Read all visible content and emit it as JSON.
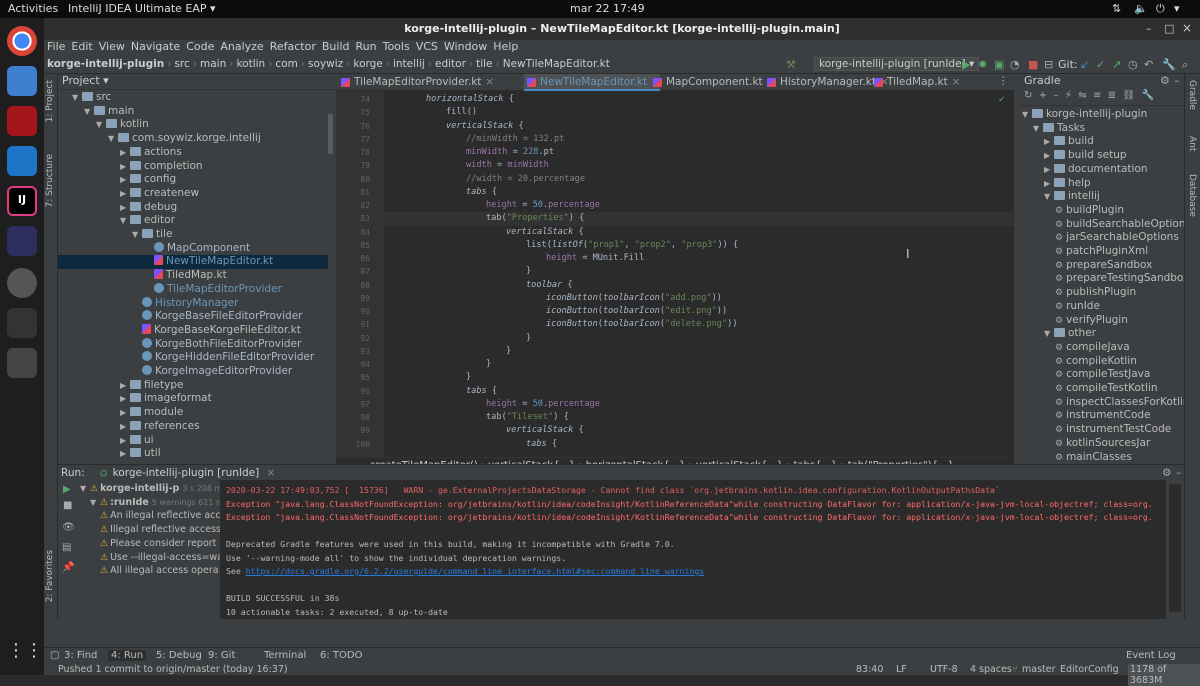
{
  "gnome": {
    "activities": "Activities",
    "app": "IntelliJ IDEA Ultimate EAP ▾",
    "clock": "mar 22  17:49"
  },
  "window": {
    "title": "korge-intellij-plugin – NewTileMapEditor.kt [korge-intellij-plugin.main]"
  },
  "menu": [
    "File",
    "Edit",
    "View",
    "Navigate",
    "Code",
    "Analyze",
    "Refactor",
    "Build",
    "Run",
    "Tools",
    "VCS",
    "Window",
    "Help"
  ],
  "nav": {
    "crumbs": [
      "korge-intellij-plugin",
      "src",
      "main",
      "kotlin",
      "com",
      "soywiz",
      "korge",
      "intellij",
      "editor",
      "tile",
      "NewTileMapEditor.kt"
    ],
    "run_config": "korge-intellij-plugin [runIde] ▾",
    "git": "Git:"
  },
  "left_strip": {
    "project": "1: Project",
    "structure": "7: Structure",
    "favorites": "2: Favorites"
  },
  "right_strip": {
    "gradle": "Gradle",
    "ant": "Ant",
    "database": "Database"
  },
  "project": {
    "header": "Project ▾",
    "rows": [
      {
        "label": "src",
        "depth": 1,
        "open": true,
        "kind": "folder"
      },
      {
        "label": "main",
        "depth": 2,
        "open": true,
        "kind": "folder"
      },
      {
        "label": "kotlin",
        "depth": 3,
        "open": true,
        "kind": "folder"
      },
      {
        "label": "com.soywiz.korge.intellij",
        "depth": 4,
        "open": true,
        "kind": "folder"
      },
      {
        "label": "actions",
        "depth": 5,
        "open": false,
        "kind": "folder"
      },
      {
        "label": "completion",
        "depth": 5,
        "open": false,
        "kind": "folder"
      },
      {
        "label": "config",
        "depth": 5,
        "open": false,
        "kind": "folder"
      },
      {
        "label": "createnew",
        "depth": 5,
        "open": false,
        "kind": "folder"
      },
      {
        "label": "debug",
        "depth": 5,
        "open": false,
        "kind": "folder"
      },
      {
        "label": "editor",
        "depth": 5,
        "open": true,
        "kind": "folder"
      },
      {
        "label": "tile",
        "depth": 6,
        "open": true,
        "kind": "folder"
      },
      {
        "label": "MapComponent",
        "depth": 7,
        "kind": "class"
      },
      {
        "label": "NewTileMapEditor.kt",
        "depth": 7,
        "kind": "kt",
        "selected": true
      },
      {
        "label": "TiledMap.kt",
        "depth": 7,
        "kind": "kt"
      },
      {
        "label": "TileMapEditorProvider",
        "depth": 7,
        "kind": "class"
      },
      {
        "label": "HistoryManager",
        "depth": 6,
        "kind": "class"
      },
      {
        "label": "KorgeBaseFileEditorProvider",
        "depth": 6,
        "kind": "class"
      },
      {
        "label": "KorgeBaseKorgeFileEditor.kt",
        "depth": 6,
        "kind": "kt"
      },
      {
        "label": "KorgeBothFileEditorProvider",
        "depth": 6,
        "kind": "class"
      },
      {
        "label": "KorgeHiddenFileEditorProvider",
        "depth": 6,
        "kind": "class"
      },
      {
        "label": "KorgeImageEditorProvider",
        "depth": 6,
        "kind": "class"
      },
      {
        "label": "filetype",
        "depth": 5,
        "open": false,
        "kind": "folder"
      },
      {
        "label": "imageformat",
        "depth": 5,
        "open": false,
        "kind": "folder"
      },
      {
        "label": "module",
        "depth": 5,
        "open": false,
        "kind": "folder"
      },
      {
        "label": "references",
        "depth": 5,
        "open": false,
        "kind": "folder"
      },
      {
        "label": "ui",
        "depth": 5,
        "open": false,
        "kind": "folder"
      },
      {
        "label": "util",
        "depth": 5,
        "open": false,
        "kind": "folder"
      }
    ]
  },
  "tabs": [
    {
      "label": "TileMapEditorProvider.kt",
      "active": false
    },
    {
      "label": "NewTileMapEditor.kt",
      "active": true
    },
    {
      "label": "MapComponent.kt",
      "active": false
    },
    {
      "label": "HistoryManager.kt",
      "active": false
    },
    {
      "label": "TiledMap.kt",
      "active": false
    }
  ],
  "code": {
    "current_line": 83,
    "lines": [
      {
        "n": 74,
        "i": 2,
        "t": [
          [
            "horizontalStack",
            "it"
          ],
          [
            " {",
            ""
          ]
        ]
      },
      {
        "n": 75,
        "i": 3,
        "t": [
          [
            "fill()",
            ""
          ]
        ]
      },
      {
        "n": 76,
        "i": 3,
        "t": [
          [
            "verticalStack",
            "it"
          ],
          [
            " {",
            ""
          ]
        ]
      },
      {
        "n": 77,
        "i": 4,
        "t": [
          [
            "//minWidth = 132.pt",
            "cmt"
          ]
        ]
      },
      {
        "n": 78,
        "i": 4,
        "t": [
          [
            "minWidth",
            "prop"
          ],
          [
            " = ",
            ""
          ],
          [
            "228",
            "num"
          ],
          [
            ".pt",
            ""
          ]
        ]
      },
      {
        "n": 79,
        "i": 4,
        "t": [
          [
            "width",
            "prop"
          ],
          [
            " = ",
            ""
          ],
          [
            "minWidth",
            "prop"
          ]
        ]
      },
      {
        "n": 80,
        "i": 4,
        "t": [
          [
            "//width = 20.percentage",
            "cmt"
          ]
        ]
      },
      {
        "n": 81,
        "i": 4,
        "t": [
          [
            "tabs",
            "it"
          ],
          [
            " {",
            ""
          ]
        ]
      },
      {
        "n": 82,
        "i": 5,
        "t": [
          [
            "height",
            "prop"
          ],
          [
            " = ",
            ""
          ],
          [
            "50",
            "num"
          ],
          [
            ".",
            ""
          ],
          [
            "percentage",
            "prop"
          ]
        ]
      },
      {
        "n": 83,
        "i": 5,
        "t": [
          [
            "tab(",
            ""
          ],
          [
            "\"Properties\"",
            "str"
          ],
          [
            ") {",
            ""
          ]
        ]
      },
      {
        "n": 84,
        "i": 6,
        "t": [
          [
            "verticalStack",
            "it"
          ],
          [
            " {",
            ""
          ]
        ]
      },
      {
        "n": 85,
        "i": 7,
        "t": [
          [
            "list(",
            ""
          ],
          [
            "listOf",
            "it"
          ],
          [
            "(",
            ""
          ],
          [
            "\"prop1\"",
            "str"
          ],
          [
            ", ",
            ""
          ],
          [
            "\"prop2\"",
            "str"
          ],
          [
            ", ",
            ""
          ],
          [
            "\"prop3\"",
            "str"
          ],
          [
            ")) {",
            ""
          ]
        ]
      },
      {
        "n": 86,
        "i": 8,
        "t": [
          [
            "height",
            "prop"
          ],
          [
            " = MUnit.Fill",
            ""
          ]
        ]
      },
      {
        "n": 87,
        "i": 7,
        "t": [
          [
            "}",
            ""
          ]
        ]
      },
      {
        "n": 88,
        "i": 7,
        "t": [
          [
            "toolbar",
            "it"
          ],
          [
            " {",
            ""
          ]
        ]
      },
      {
        "n": 89,
        "i": 8,
        "t": [
          [
            "iconButton",
            "it"
          ],
          [
            "(",
            ""
          ],
          [
            "toolbarIcon",
            "it"
          ],
          [
            "(",
            ""
          ],
          [
            "\"add.png\"",
            "str"
          ],
          [
            "))",
            ""
          ]
        ]
      },
      {
        "n": 90,
        "i": 8,
        "t": [
          [
            "iconButton",
            "it"
          ],
          [
            "(",
            ""
          ],
          [
            "toolbarIcon",
            "it"
          ],
          [
            "(",
            ""
          ],
          [
            "\"edit.png\"",
            "str"
          ],
          [
            "))",
            ""
          ]
        ]
      },
      {
        "n": 91,
        "i": 8,
        "t": [
          [
            "iconButton",
            "it"
          ],
          [
            "(",
            ""
          ],
          [
            "toolbarIcon",
            "it"
          ],
          [
            "(",
            ""
          ],
          [
            "\"delete.png\"",
            "str"
          ],
          [
            "))",
            ""
          ]
        ]
      },
      {
        "n": 92,
        "i": 7,
        "t": [
          [
            "}",
            ""
          ]
        ]
      },
      {
        "n": 93,
        "i": 6,
        "t": [
          [
            "}",
            ""
          ]
        ]
      },
      {
        "n": 94,
        "i": 5,
        "t": [
          [
            "}",
            ""
          ]
        ]
      },
      {
        "n": 95,
        "i": 4,
        "t": [
          [
            "}",
            ""
          ]
        ]
      },
      {
        "n": 96,
        "i": 4,
        "t": [
          [
            "tabs",
            "it"
          ],
          [
            " {",
            ""
          ]
        ]
      },
      {
        "n": 97,
        "i": 5,
        "t": [
          [
            "height",
            "prop"
          ],
          [
            " = ",
            ""
          ],
          [
            "50",
            "num"
          ],
          [
            ".",
            ""
          ],
          [
            "percentage",
            "prop"
          ]
        ]
      },
      {
        "n": 98,
        "i": 5,
        "t": [
          [
            "tab(",
            ""
          ],
          [
            "\"Tileset\"",
            "str"
          ],
          [
            ") {",
            ""
          ]
        ]
      },
      {
        "n": 99,
        "i": 6,
        "t": [
          [
            "verticalStack",
            "it"
          ],
          [
            " {",
            ""
          ]
        ]
      },
      {
        "n": 100,
        "i": 7,
        "t": [
          [
            "tabs",
            "it"
          ],
          [
            " {",
            ""
          ]
        ]
      }
    ]
  },
  "editor_breadcrumb": [
    "createTileMapEditor()",
    "verticalStack{...}",
    "horizontalStack{...}",
    "verticalStack{...}",
    "tabs{...}",
    "tab(\"Properties\"){...}"
  ],
  "gradle": {
    "header": "Gradle",
    "rows": [
      {
        "label": "korge-intellij-plugin",
        "depth": 0,
        "open": true
      },
      {
        "label": "Tasks",
        "depth": 1,
        "open": true
      },
      {
        "label": "build",
        "depth": 2,
        "open": false
      },
      {
        "label": "build setup",
        "depth": 2,
        "open": false
      },
      {
        "label": "documentation",
        "depth": 2,
        "open": false
      },
      {
        "label": "help",
        "depth": 2,
        "open": false
      },
      {
        "label": "intellij",
        "depth": 2,
        "open": true
      },
      {
        "label": "buildPlugin",
        "depth": 3,
        "task": true
      },
      {
        "label": "buildSearchableOptions",
        "depth": 3,
        "task": true
      },
      {
        "label": "jarSearchableOptions",
        "depth": 3,
        "task": true
      },
      {
        "label": "patchPluginXml",
        "depth": 3,
        "task": true
      },
      {
        "label": "prepareSandbox",
        "depth": 3,
        "task": true
      },
      {
        "label": "prepareTestingSandbox",
        "depth": 3,
        "task": true
      },
      {
        "label": "publishPlugin",
        "depth": 3,
        "task": true
      },
      {
        "label": "runIde",
        "depth": 3,
        "task": true
      },
      {
        "label": "verifyPlugin",
        "depth": 3,
        "task": true
      },
      {
        "label": "other",
        "depth": 2,
        "open": true
      },
      {
        "label": "compileJava",
        "depth": 3,
        "task": true
      },
      {
        "label": "compileKotlin",
        "depth": 3,
        "task": true
      },
      {
        "label": "compileTestJava",
        "depth": 3,
        "task": true
      },
      {
        "label": "compileTestKotlin",
        "depth": 3,
        "task": true
      },
      {
        "label": "inspectClassesForKotlinIC",
        "depth": 3,
        "task": true
      },
      {
        "label": "instrumentCode",
        "depth": 3,
        "task": true
      },
      {
        "label": "instrumentTestCode",
        "depth": 3,
        "task": true
      },
      {
        "label": "kotlinSourcesJar",
        "depth": 3,
        "task": true
      },
      {
        "label": "mainClasses",
        "depth": 3,
        "task": true
      }
    ]
  },
  "run": {
    "header_label": "Run:",
    "tab": "korge-intellij-plugin [runIde]",
    "tree": [
      {
        "label": "korge-intellij-p",
        "meta": "3 s 208 ms",
        "depth": 0
      },
      {
        "label": ":runIde",
        "meta": "5 warnings 611 ms",
        "depth": 1
      },
      {
        "label": "An illegal reflective acc",
        "depth": 2
      },
      {
        "label": "Illegal reflective access",
        "depth": 2
      },
      {
        "label": "Please consider report",
        "depth": 2
      },
      {
        "label": "Use --illegal-access=wa",
        "depth": 2
      },
      {
        "label": "All illegal access opera",
        "depth": 2
      }
    ],
    "console": [
      {
        "t": "2020-03-22 17:49:03,752 [  15736]   WARN - ge.ExternalProjectsDataStorage - Cannot find class `org.jetbrains.kotlin.idea.configuration.KotlinOutputPathsData`",
        "c": "wrn"
      },
      {
        "t": "Exception \"java.lang.ClassNotFoundException: org/jetbrains/kotlin/idea/codeInsight/KotlinReferenceData\"while constructing DataFlavor for: application/x-java-jvm-local-objectref; class=org.",
        "c": "err"
      },
      {
        "t": "Exception \"java.lang.ClassNotFoundException: org/jetbrains/kotlin/idea/codeInsight/KotlinReferenceData\"while constructing DataFlavor for: application/x-java-jvm-local-objectref; class=org.",
        "c": "err"
      },
      {
        "t": "",
        "c": ""
      },
      {
        "t": "Deprecated Gradle features were used in this build, making it incompatible with Gradle 7.0.",
        "c": ""
      },
      {
        "t": "Use '--warning-mode all' to show the individual deprecation warnings.",
        "c": ""
      },
      {
        "t": "See ",
        "c": "",
        "link": "https://docs.gradle.org/6.2.2/userguide/command_line_interface.html#sec:command_line_warnings"
      },
      {
        "t": "",
        "c": ""
      },
      {
        "t": "BUILD SUCCESSFUL in 38s",
        "c": ""
      },
      {
        "t": "10 actionable tasks: 2 executed, 8 up-to-date",
        "c": ""
      },
      {
        "t": "17:49:25: Task execution finished 'runIde'.",
        "c": ""
      }
    ]
  },
  "bottom_tools": {
    "find": "3: Find",
    "run": "4: Run",
    "debug": "5: Debug",
    "git": "9: Git",
    "terminal": "Terminal",
    "todo": "6: TODO",
    "event_log": "Event Log"
  },
  "status": {
    "commit": "Pushed 1 commit to origin/master (today 16:37)",
    "position": "83:40",
    "line_sep": "LF",
    "encoding": "UTF-8",
    "indent": "4 spaces",
    "branch": "master",
    "editorconfig": "EditorConfig",
    "memory": "1178 of 3683M"
  }
}
